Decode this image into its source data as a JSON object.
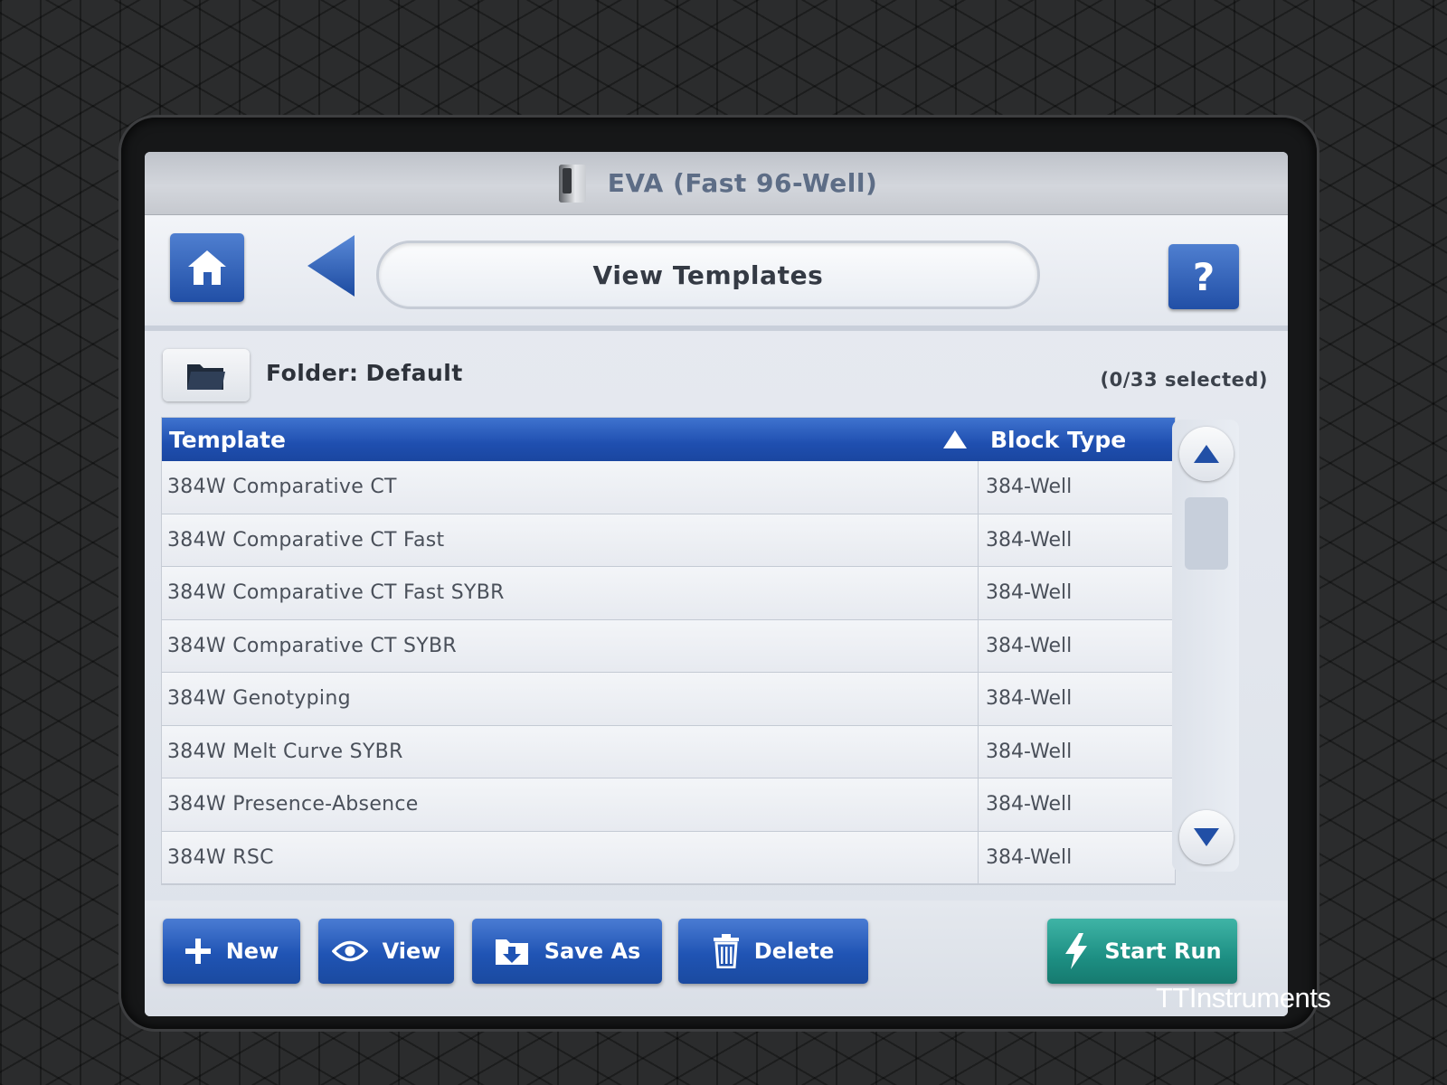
{
  "window": {
    "title": "EVA (Fast 96-Well)"
  },
  "toolbar": {
    "home_icon": "home-icon",
    "back_icon": "back-arrow-icon",
    "page_title": "View Templates",
    "help_label": "?"
  },
  "folder": {
    "label": "Folder:",
    "value": "Default",
    "icon": "folder-icon",
    "selected_count": "(0/33 selected)"
  },
  "table": {
    "columns": {
      "template": "Template",
      "block_type": "Block Type"
    },
    "sort_icon": "sort-ascending-icon",
    "rows": [
      {
        "template": "384W Comparative CT",
        "block_type": "384-Well"
      },
      {
        "template": "384W Comparative CT Fast",
        "block_type": "384-Well"
      },
      {
        "template": "384W Comparative CT Fast SYBR",
        "block_type": "384-Well"
      },
      {
        "template": "384W Comparative CT SYBR",
        "block_type": "384-Well"
      },
      {
        "template": "384W Genotyping",
        "block_type": "384-Well"
      },
      {
        "template": "384W Melt Curve SYBR",
        "block_type": "384-Well"
      },
      {
        "template": "384W Presence-Absence",
        "block_type": "384-Well"
      },
      {
        "template": "384W RSC",
        "block_type": "384-Well"
      }
    ]
  },
  "actions": {
    "new_label": "New",
    "view_label": "View",
    "saveas_label": "Save As",
    "delete_label": "Delete",
    "start_label": "Start Run"
  },
  "colors": {
    "accent_blue": "#214fa6",
    "start_green": "#1d8f83"
  },
  "watermark": "TTInstruments"
}
